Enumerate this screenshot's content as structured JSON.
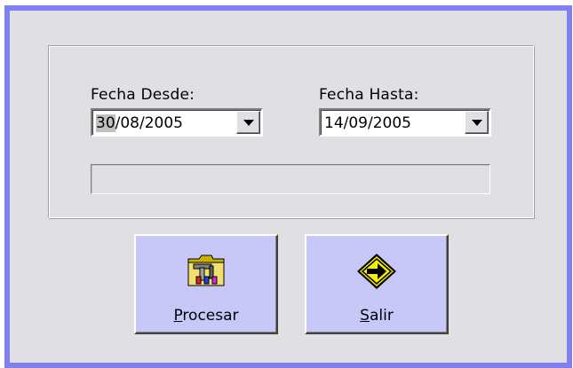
{
  "dialog": {
    "fecha_desde": {
      "label": "Fecha Desde:",
      "day_selected": "30",
      "rest": "/08/2005"
    },
    "fecha_hasta": {
      "label": "Fecha Hasta:",
      "value": "14/09/2005"
    },
    "progress": {
      "value": 0
    },
    "buttons": {
      "procesar": {
        "mnemonic": "P",
        "rest": "rocesar",
        "icon": "tools-folder-icon"
      },
      "salir": {
        "mnemonic": "S",
        "rest": "alir",
        "icon": "exit-arrow-sign-icon"
      }
    },
    "colors": {
      "frame_border": "#8080f0",
      "window_bg": "#e0dfe3",
      "button_bg": "#c8c8f8"
    }
  }
}
